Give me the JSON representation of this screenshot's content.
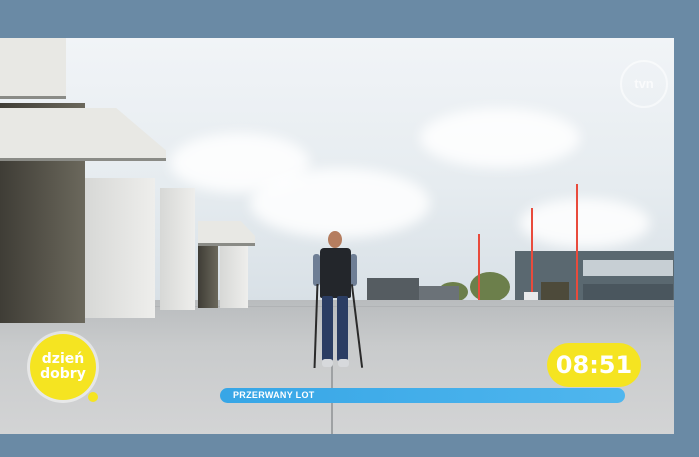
{
  "broadcast": {
    "logo_line1": "dzień",
    "logo_line2": "dobry",
    "clock": "08:51",
    "ticker_text": "PRZERWANY LOT",
    "watermark": "tvn"
  },
  "colors": {
    "frame_background": "#6a8aa5",
    "logo_yellow": "#f5e421",
    "ticker_blue": "#37a6e6",
    "text_white": "#ffffff"
  },
  "icons": [
    "tvn-watermark-icon",
    "dzien-dobry-logo-icon"
  ]
}
